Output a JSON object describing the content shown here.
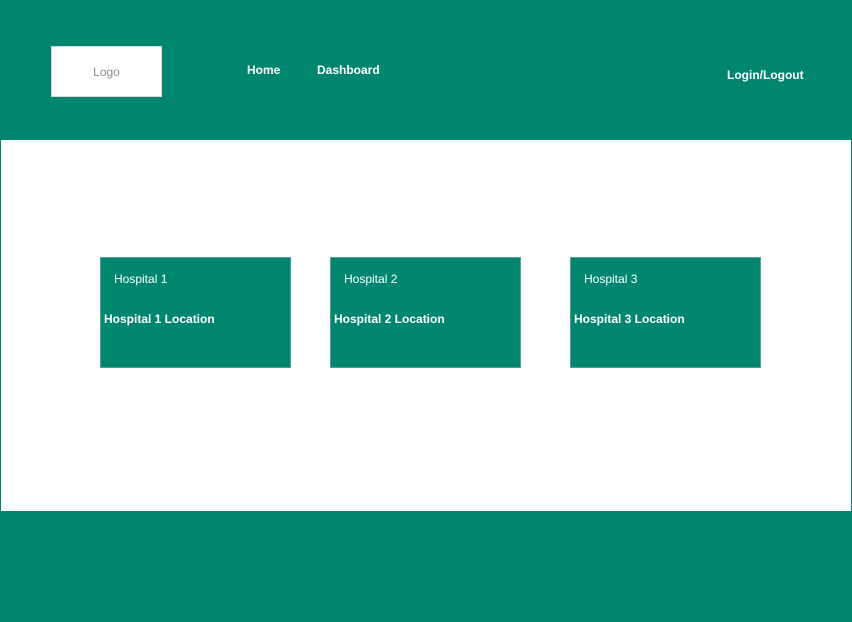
{
  "header": {
    "logo_text": "Logo",
    "nav": {
      "home": "Home",
      "dashboard": "Dashboard",
      "login_logout": "Login/Logout"
    }
  },
  "hospitals": [
    {
      "name": "Hospital 1",
      "location": "Hospital 1 Location"
    },
    {
      "name": "Hospital 2",
      "location": "Hospital 2 Location"
    },
    {
      "name": "Hospital 3",
      "location": "Hospital 3 Location"
    }
  ],
  "colors": {
    "primary": "#00856f",
    "background": "#ffffff",
    "text_on_primary": "#ffffff",
    "logo_text": "#8c8c8c"
  }
}
